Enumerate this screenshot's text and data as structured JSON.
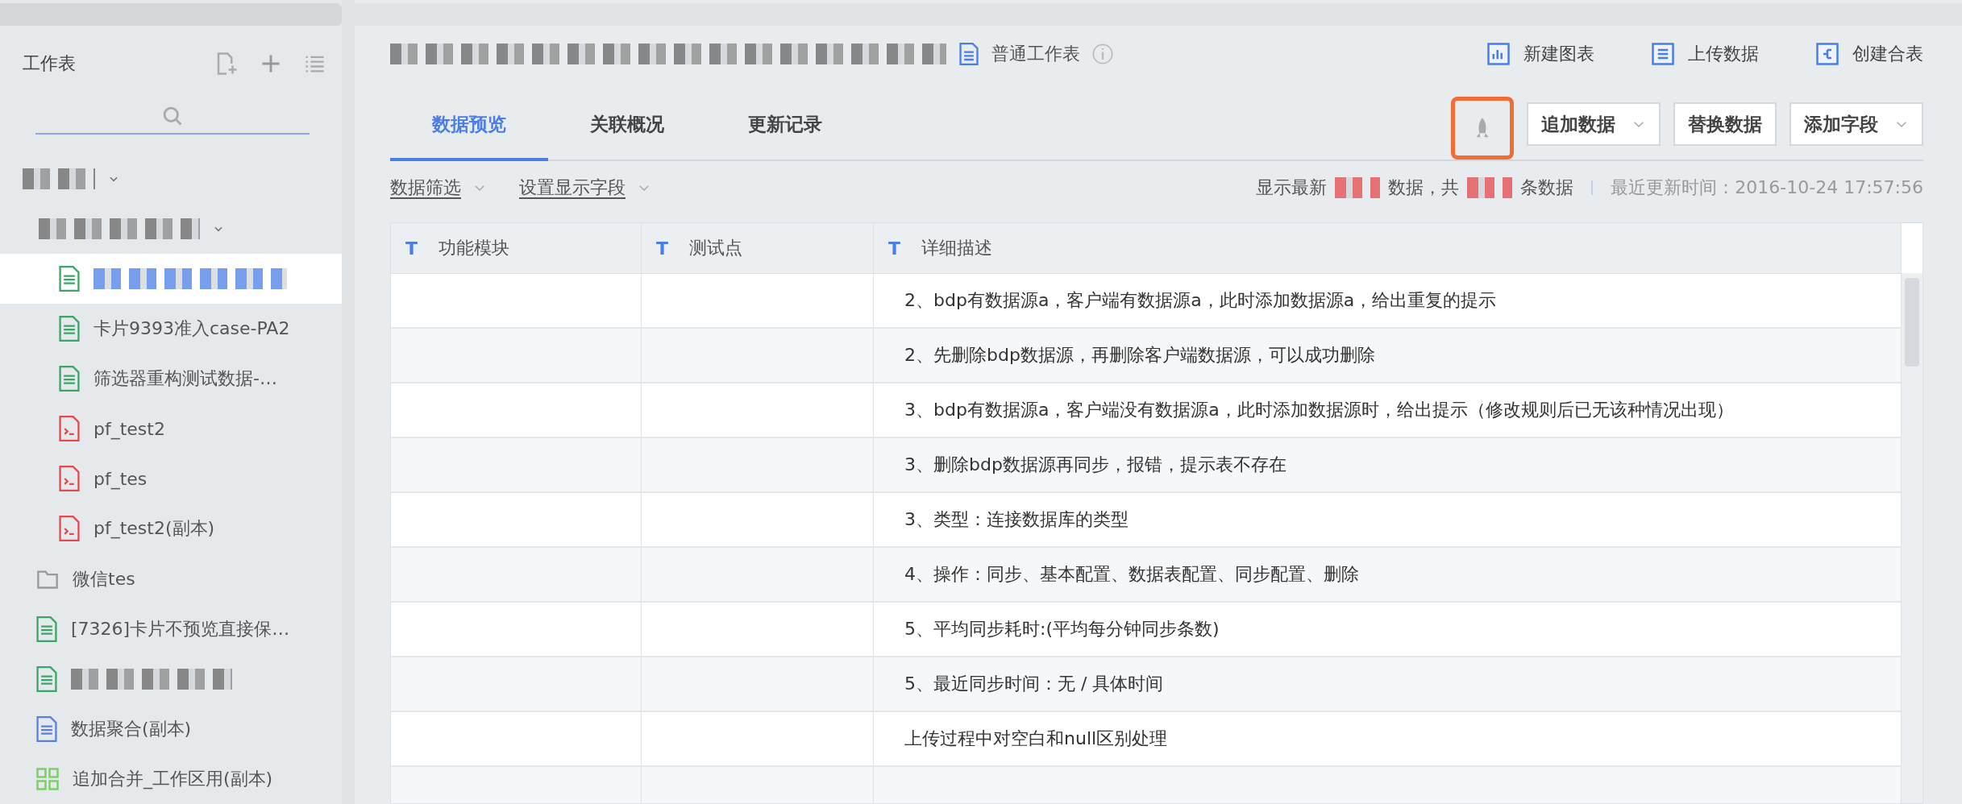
{
  "sidebar": {
    "title": "工作表",
    "tree": [
      {
        "kind": "group",
        "redacted": true,
        "selected": false,
        "expanded": true,
        "children": [
          {
            "kind": "group",
            "redacted": true,
            "selected": false,
            "expanded": true,
            "children": [
              {
                "kind": "sheet",
                "redacted": true,
                "selected": true
              },
              {
                "kind": "sheet",
                "label": "卡片9393准入case-PA2",
                "selected": false
              },
              {
                "kind": "sheet",
                "label": "筛选器重构测试数据-…",
                "selected": false
              },
              {
                "kind": "script",
                "label": "pf_test2",
                "selected": false
              },
              {
                "kind": "script",
                "label": "pf_tes",
                "selected": false
              },
              {
                "kind": "script",
                "label": "pf_test2(副本)",
                "selected": false
              }
            ]
          },
          {
            "kind": "folder",
            "label": "微信tes",
            "selected": false
          },
          {
            "kind": "sheet",
            "label": "[7326]卡片不预览直接保…",
            "selected": false
          },
          {
            "kind": "sheet",
            "redacted": true,
            "selected": false
          },
          {
            "kind": "aggregate",
            "label": "数据聚合(副本)",
            "selected": false
          },
          {
            "kind": "merge",
            "label": "追加合并_工作区用(副本)",
            "selected": false
          }
        ]
      }
    ]
  },
  "header": {
    "type_label": "普通工作表",
    "actions": [
      {
        "kind": "chart",
        "label": "新建图表"
      },
      {
        "kind": "upload",
        "label": "上传数据"
      },
      {
        "kind": "merge",
        "label": "创建合表"
      }
    ]
  },
  "tabs": [
    {
      "label": "数据预览",
      "selected": true
    },
    {
      "label": "关联概况",
      "selected": false
    },
    {
      "label": "更新记录",
      "selected": false
    }
  ],
  "toolbar": {
    "rocket_highlighted": true,
    "buttons": [
      {
        "label": "追加数据",
        "dropdown": true
      },
      {
        "label": "替换数据",
        "dropdown": false
      },
      {
        "label": "添加字段",
        "dropdown": true
      }
    ]
  },
  "filters": [
    "数据筛选",
    "设置显示字段"
  ],
  "summary": {
    "prefix": "显示最新",
    "middle": "数据，共",
    "suffix": "条数据",
    "updated": "最近更新时间：2016-10-24 17:57:56"
  },
  "table": {
    "columns": [
      {
        "type_icon": "T",
        "label": "功能模块"
      },
      {
        "type_icon": "T",
        "label": "测试点"
      },
      {
        "type_icon": "T",
        "label": "详细描述"
      }
    ],
    "rows": [
      [
        "",
        "",
        "2、bdp有数据源a，客户端有数据源a，此时添加数据源a，给出重复的提示"
      ],
      [
        "",
        "",
        "2、先删除bdp数据源，再删除客户端数据源，可以成功删除"
      ],
      [
        "",
        "",
        "3、bdp有数据源a，客户端没有数据源a，此时添加数据源时，给出提示（修改规则后已无该种情况出现）"
      ],
      [
        "",
        "",
        "3、删除bdp数据源再同步，报错，提示表不存在"
      ],
      [
        "",
        "",
        "3、类型：连接数据库的类型"
      ],
      [
        "",
        "",
        "4、操作：同步、基本配置、数据表配置、同步配置、删除"
      ],
      [
        "",
        "",
        "5、平均同步耗时:(平均每分钟同步条数)"
      ],
      [
        "",
        "",
        "5、最近同步时间：无 / 具体时间"
      ],
      [
        "",
        "",
        "上传过程中对空白和null区别处理"
      ],
      [
        "",
        "",
        ""
      ]
    ]
  }
}
